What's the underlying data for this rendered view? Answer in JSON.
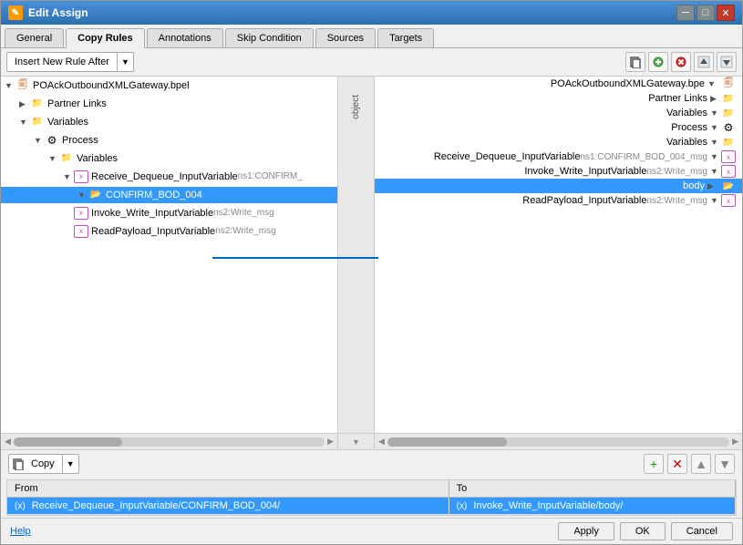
{
  "window": {
    "title": "Edit Assign",
    "title_icon": "✎"
  },
  "tabs": [
    {
      "label": "General",
      "active": false
    },
    {
      "label": "Copy Rules",
      "active": true
    },
    {
      "label": "Annotations",
      "active": false
    },
    {
      "label": "Skip Condition",
      "active": false
    },
    {
      "label": "Sources",
      "active": false
    },
    {
      "label": "Targets",
      "active": false
    }
  ],
  "toolbar": {
    "insert_label": "Insert New Rule After",
    "icons": [
      "📋",
      "👤",
      "✖",
      "📑",
      "📋"
    ]
  },
  "left_tree": {
    "items": [
      {
        "indent": 0,
        "icon": "file",
        "label": "POAckOutboundXMLGateway.bpel",
        "expand": true
      },
      {
        "indent": 1,
        "icon": "folder",
        "label": "Partner Links",
        "expand": true
      },
      {
        "indent": 1,
        "icon": "folder",
        "label": "Variables",
        "expand": true
      },
      {
        "indent": 2,
        "icon": "folder",
        "label": "Process",
        "expand": true
      },
      {
        "indent": 3,
        "icon": "folder",
        "label": "Variables",
        "expand": true
      },
      {
        "indent": 4,
        "icon": "var",
        "label": "Receive_Dequeue_InputVariable",
        "suffix": " ns1:CONFIRM_",
        "expand": true
      },
      {
        "indent": 5,
        "icon": "folder",
        "label": "CONFIRM_BOD_004",
        "expand": false,
        "selected": true
      },
      {
        "indent": 4,
        "icon": "var",
        "label": "Invoke_Write_InputVariable",
        "suffix": " ns2:Write_msg",
        "expand": false
      },
      {
        "indent": 4,
        "icon": "var",
        "label": "ReadPayload_InputVariable",
        "suffix": " ns2:Write_msg",
        "expand": false
      }
    ]
  },
  "right_tree": {
    "items": [
      {
        "label": "POAckOutboundXMLGateway.bpe",
        "icon": "file",
        "expand": true
      },
      {
        "label": "Partner Links",
        "icon": "folder",
        "expand": true
      },
      {
        "label": "Variables",
        "icon": "folder",
        "expand": true
      },
      {
        "label": "Process",
        "icon": "folder",
        "expand": true
      },
      {
        "label": "Variables",
        "icon": "folder",
        "expand": true
      },
      {
        "label": "Receive_Dequeue_InputVariable ns1:CONFIRM_BOD_004_msg",
        "icon": "var",
        "expand": true
      },
      {
        "label": "Invoke_Write_InputVariable ns2:Write_msg",
        "icon": "var",
        "expand": true
      },
      {
        "label": "body",
        "icon": "folder",
        "expand": false,
        "selected": true
      },
      {
        "label": "ReadPayload_InputVariable ns2:Write_msg",
        "icon": "var",
        "expand": false
      }
    ]
  },
  "copy_button": {
    "icon": "📋",
    "label": "Copy"
  },
  "copy_table": {
    "headers": [
      "From",
      "To"
    ],
    "rows": [
      {
        "from_icon": "(*)",
        "from": "Receive_Dequeue_InputVariable/CONFIRM_BOD_004/",
        "to_icon": "(*)",
        "to": "Invoke_Write_InputVariable/body/",
        "selected": true
      }
    ]
  },
  "status_bar": {
    "help_label": "Help",
    "apply_label": "Apply",
    "ok_label": "OK",
    "cancel_label": "Cancel"
  }
}
